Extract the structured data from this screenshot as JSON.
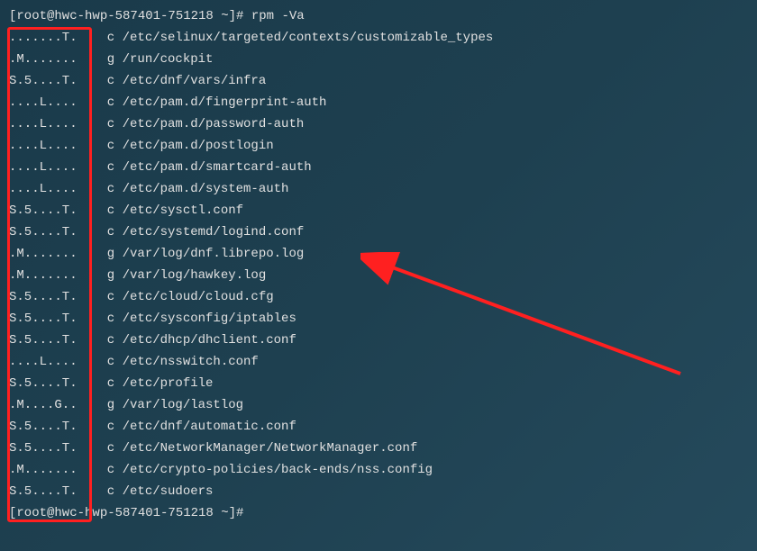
{
  "prompt1": "[root@hwc-hwp-587401-751218 ~]# rpm -Va",
  "prompt2": "[root@hwc-hwp-587401-751218 ~]# ",
  "lines": [
    {
      "flags": ".......T.",
      "type": "c",
      "path": "/etc/selinux/targeted/contexts/customizable_types"
    },
    {
      "flags": ".M.......",
      "type": "g",
      "path": "/run/cockpit"
    },
    {
      "flags": "S.5....T.",
      "type": "c",
      "path": "/etc/dnf/vars/infra"
    },
    {
      "flags": "....L....",
      "type": "c",
      "path": "/etc/pam.d/fingerprint-auth"
    },
    {
      "flags": "....L....",
      "type": "c",
      "path": "/etc/pam.d/password-auth"
    },
    {
      "flags": "....L....",
      "type": "c",
      "path": "/etc/pam.d/postlogin"
    },
    {
      "flags": "....L....",
      "type": "c",
      "path": "/etc/pam.d/smartcard-auth"
    },
    {
      "flags": "....L....",
      "type": "c",
      "path": "/etc/pam.d/system-auth"
    },
    {
      "flags": "S.5....T.",
      "type": "c",
      "path": "/etc/sysctl.conf"
    },
    {
      "flags": "S.5....T.",
      "type": "c",
      "path": "/etc/systemd/logind.conf"
    },
    {
      "flags": ".M.......",
      "type": "g",
      "path": "/var/log/dnf.librepo.log"
    },
    {
      "flags": ".M.......",
      "type": "g",
      "path": "/var/log/hawkey.log"
    },
    {
      "flags": "S.5....T.",
      "type": "c",
      "path": "/etc/cloud/cloud.cfg"
    },
    {
      "flags": "S.5....T.",
      "type": "c",
      "path": "/etc/sysconfig/iptables"
    },
    {
      "flags": "S.5....T.",
      "type": "c",
      "path": "/etc/dhcp/dhclient.conf"
    },
    {
      "flags": "....L....",
      "type": "c",
      "path": "/etc/nsswitch.conf"
    },
    {
      "flags": "S.5....T.",
      "type": "c",
      "path": "/etc/profile"
    },
    {
      "flags": ".M....G..",
      "type": "g",
      "path": "/var/log/lastlog"
    },
    {
      "flags": "S.5....T.",
      "type": "c",
      "path": "/etc/dnf/automatic.conf"
    },
    {
      "flags": "S.5....T.",
      "type": "c",
      "path": "/etc/NetworkManager/NetworkManager.conf"
    },
    {
      "flags": ".M.......",
      "type": "c",
      "path": "/etc/crypto-policies/back-ends/nss.config"
    },
    {
      "flags": "S.5....T.",
      "type": "c",
      "path": "/etc/sudoers"
    }
  ]
}
